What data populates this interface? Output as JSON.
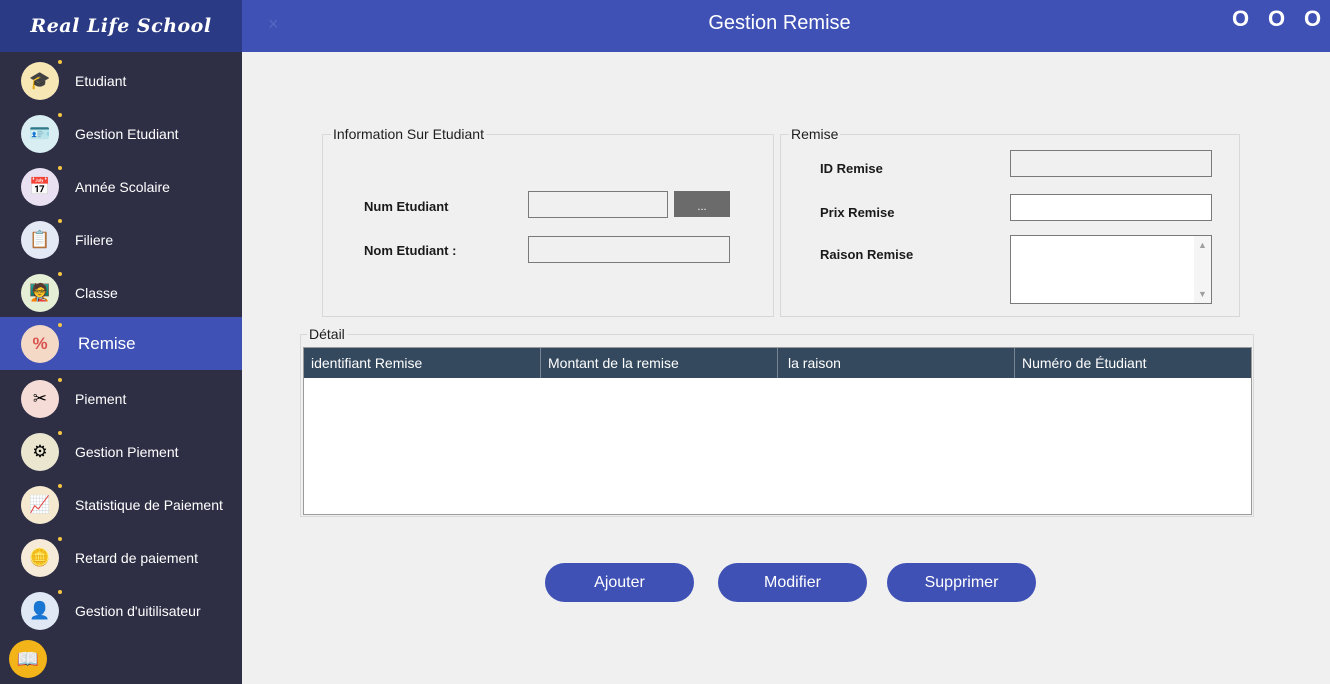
{
  "app": {
    "brand": "Real Life School",
    "title": "Gestion Remise",
    "close_glyph": "×",
    "window_controls": [
      "O",
      "O",
      "O"
    ]
  },
  "sidebar": {
    "items": [
      {
        "label": "Etudiant",
        "icon": "graduate-icon",
        "glyph": "🎓",
        "color": "#f6e7b5"
      },
      {
        "label": "Gestion Etudiant",
        "icon": "id-card-icon",
        "glyph": "🪪",
        "color": "#d8eef2"
      },
      {
        "label": "Année Scolaire",
        "icon": "calendar-check-icon",
        "glyph": "📅",
        "color": "#e9e1f2"
      },
      {
        "label": "Filiere",
        "icon": "clipboard-icon",
        "glyph": "📋",
        "color": "#e3e9f5"
      },
      {
        "label": "Classe",
        "icon": "classroom-board-icon",
        "glyph": "🧑‍🏫",
        "color": "#e5efd5"
      },
      {
        "label": "Remise",
        "icon": "discount-badge-icon",
        "glyph": "%",
        "color": "#f3d9c6",
        "active": true
      },
      {
        "label": "Piement",
        "icon": "money-scissors-icon",
        "glyph": "✂",
        "color": "#f6dcd6"
      },
      {
        "label": "Gestion Piement",
        "icon": "gear-document-icon",
        "glyph": "⚙",
        "color": "#eae6cf"
      },
      {
        "label": "Statistique de Paiement",
        "icon": "chart-board-icon",
        "glyph": "📈",
        "color": "#f5ead0"
      },
      {
        "label": "Retard de paiement",
        "icon": "hand-coin-icon",
        "glyph": "🪙",
        "color": "#f6ead8"
      },
      {
        "label": "Gestion d'uitilisateur",
        "icon": "user-list-icon",
        "glyph": "👤",
        "color": "#dfe8f4"
      }
    ],
    "bottom_icon": {
      "icon": "open-book-icon",
      "glyph": "📖"
    }
  },
  "info_group": {
    "title": "Information Sur Etudiant",
    "num_label": "Num Etudiant",
    "num_value": "",
    "browse_label": "...",
    "nom_label": "Nom Etudiant :",
    "nom_value": ""
  },
  "remise_group": {
    "title": "Remise",
    "id_label": "ID Remise",
    "id_value": "",
    "prix_label": "Prix Remise",
    "prix_value": "",
    "raison_label": "Raison Remise",
    "raison_value": ""
  },
  "detail": {
    "title": "Détail",
    "columns": [
      "identifiant Remise",
      "Montant de la remise",
      "la raison",
      "Numéro de Étudiant"
    ],
    "rows": []
  },
  "actions": {
    "add": "Ajouter",
    "edit": "Modifier",
    "delete": "Supprimer"
  },
  "colors": {
    "accent": "#3f51b5",
    "sidebar_bg": "#2e2f45",
    "brand_bg": "#2b3a84",
    "grid_header": "#34495e"
  }
}
